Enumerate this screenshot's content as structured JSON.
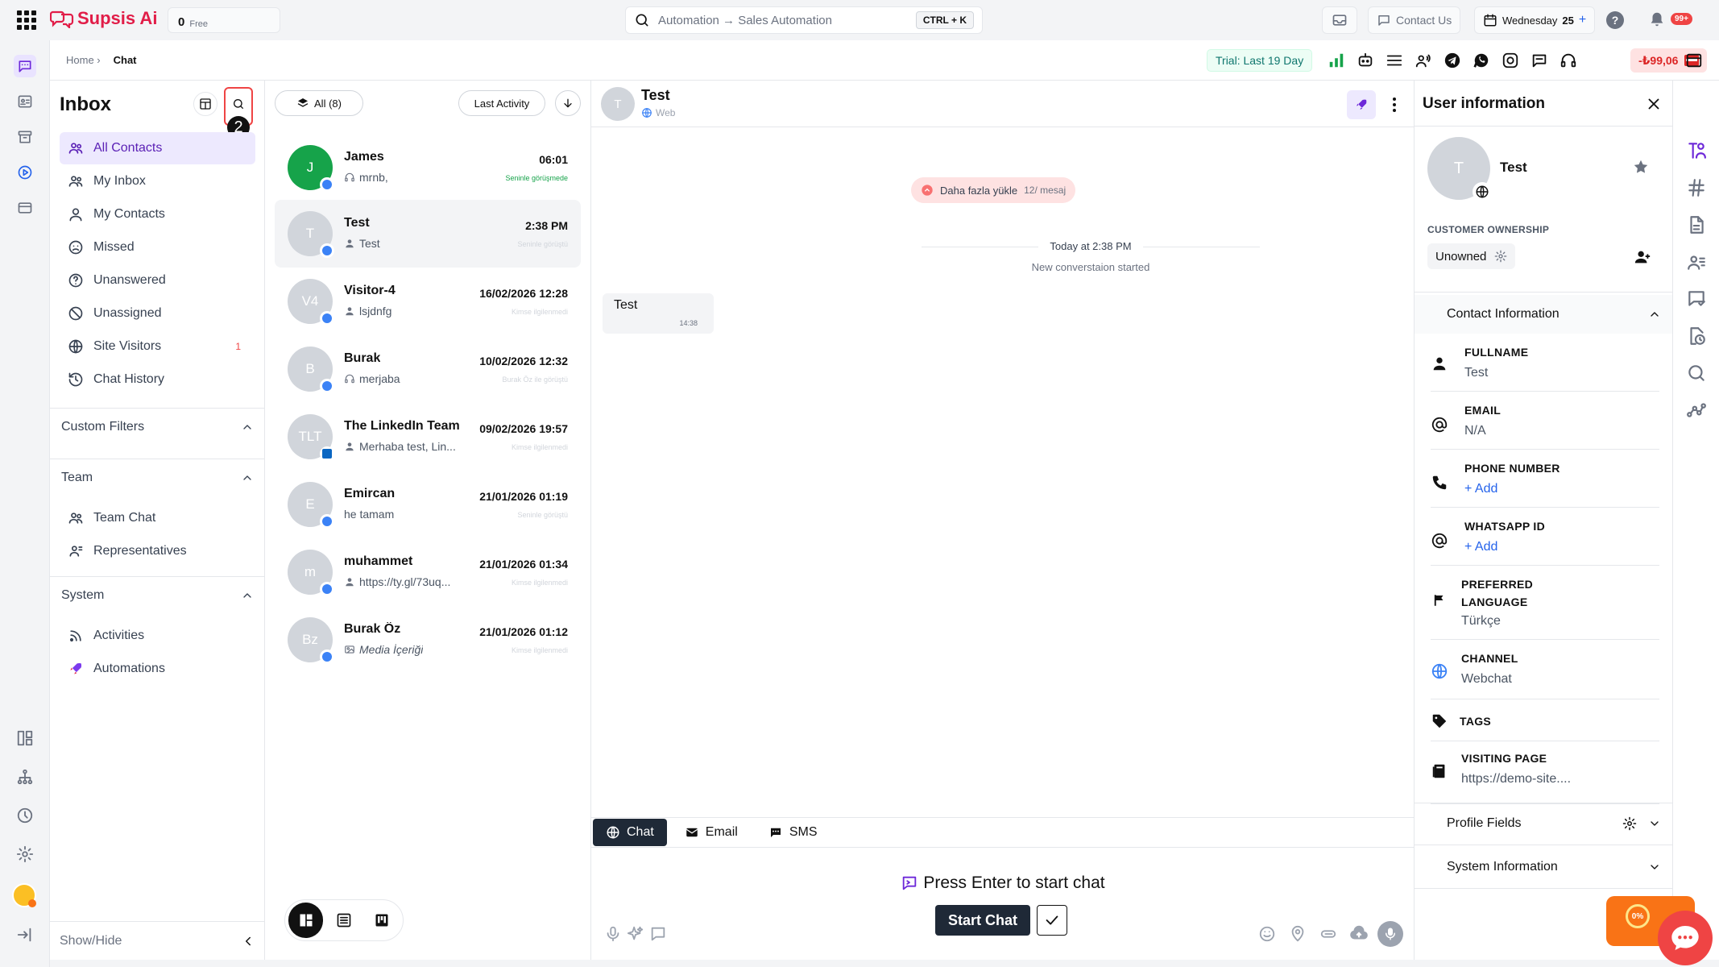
{
  "topbar": {
    "logo_text": "Supsis Ai",
    "credit_value": "0",
    "credit_label": "Free",
    "search_text": "Automation → Sales Automation",
    "search_shortcut": "CTRL + K",
    "contact_us": "Contact Us",
    "date": "Wednesday",
    "date_day": "25",
    "notification_badge": "99+"
  },
  "subbar": {
    "breadcrumb_home": "Home ›",
    "breadcrumb_current": "Chat",
    "trial": "Trial: Last 19 Day",
    "balance": "-₺99,06"
  },
  "inbox": {
    "title": "Inbox",
    "step_badge": "2",
    "nav": [
      {
        "label": "All Contacts",
        "icon": "people-icon"
      },
      {
        "label": "My Inbox",
        "icon": "people-icon"
      },
      {
        "label": "My Contacts",
        "icon": "person-icon"
      },
      {
        "label": "Missed",
        "icon": "sad-face-icon"
      },
      {
        "label": "Unanswered",
        "icon": "question-icon"
      },
      {
        "label": "Unassigned",
        "icon": "block-icon"
      },
      {
        "label": "Site Visitors",
        "icon": "globe-icon",
        "count": "1"
      },
      {
        "label": "Chat History",
        "icon": "history-icon"
      }
    ],
    "sections": {
      "custom_filters": "Custom Filters",
      "team": "Team",
      "system": "System"
    },
    "team_items": [
      "Team Chat",
      "Representatives"
    ],
    "system_items": [
      "Activities",
      "Automations"
    ],
    "show_hide": "Show/Hide"
  },
  "conversations": {
    "filter_all": "All (8)",
    "sort": "Last Activity",
    "items": [
      {
        "initials": "J",
        "name": "James",
        "preview": "mrnb,",
        "time": "06:01",
        "status": "Seninle görüşmede",
        "channel": "web"
      },
      {
        "initials": "T",
        "name": "Test",
        "preview": "Test",
        "time": "2:38 PM",
        "status": "Seninle görüştü",
        "channel": "web"
      },
      {
        "initials": "V4",
        "name": "Visitor-4",
        "preview": "lsjdnfg",
        "time": "16/02/2026 12:28",
        "status": "Kimse ilgilenmedi",
        "channel": "web"
      },
      {
        "initials": "B",
        "name": "Burak",
        "preview": "merjaba",
        "time": "10/02/2026 12:32",
        "status": "Burak Öz ile görüştü",
        "channel": "web"
      },
      {
        "initials": "TLT",
        "name": "The LinkedIn Team",
        "preview": "Merhaba test, Lin...",
        "time": "09/02/2026 19:57",
        "status": "Kimse ilgilenmedi",
        "channel": "linkedin"
      },
      {
        "initials": "E",
        "name": "Emircan",
        "preview": "he tamam",
        "time": "21/01/2026 01:19",
        "status": "Seninle görüştü",
        "channel": "web"
      },
      {
        "initials": "m",
        "name": "muhammet",
        "preview": "https://ty.gl/73uq...",
        "time": "21/01/2026 01:34",
        "status": "Kimse ilgilenmedi",
        "channel": "web"
      },
      {
        "initials": "Bz",
        "name": "Burak Öz",
        "preview": "Media İçeriği",
        "time": "21/01/2026 01:12",
        "status": "Kimse ilgilenmedi",
        "channel": "web"
      }
    ]
  },
  "chat": {
    "contact_initial": "T",
    "contact_name": "Test",
    "contact_channel": "Web",
    "load_more": "Daha fazla yükle",
    "load_more_count": "12/ mesaj",
    "day_divider": "Today at 2:38 PM",
    "started": "New converstaion started",
    "message_text": "Test",
    "message_time": "14:38",
    "tabs": [
      "Chat",
      "Email",
      "SMS"
    ],
    "enter_prompt": "Press Enter to start chat",
    "start_button": "Start Chat"
  },
  "user_info": {
    "title": "User information",
    "avatar_initial": "T",
    "name": "Test",
    "ownership_label": "CUSTOMER OWNERSHIP",
    "ownership_value": "Unowned",
    "contact_info": "Contact Information",
    "fields": {
      "fullname_label": "FULLNAME",
      "fullname_value": "Test",
      "email_label": "EMAIL",
      "email_value": "N/A",
      "phone_label": "PHONE NUMBER",
      "phone_value": "+ Add",
      "whatsapp_label": "WHATSAPP ID",
      "whatsapp_value": "+ Add",
      "language_label_1": "PREFERRED",
      "language_label_2": "LANGUAGE",
      "language_value": "Türkçe",
      "channel_label": "CHANNEL",
      "channel_value": "Webchat",
      "tags_label": "TAGS",
      "visiting_label": "VISITING PAGE",
      "visiting_value": "https://demo-site...."
    },
    "profile_fields": "Profile Fields",
    "system_information": "System Information"
  },
  "fab": {
    "percent": "0%"
  },
  "colors": {
    "accent": "#6d28d9",
    "brand": "#e11d48",
    "active_dark": "#1f2937",
    "online": "#16a34a"
  }
}
